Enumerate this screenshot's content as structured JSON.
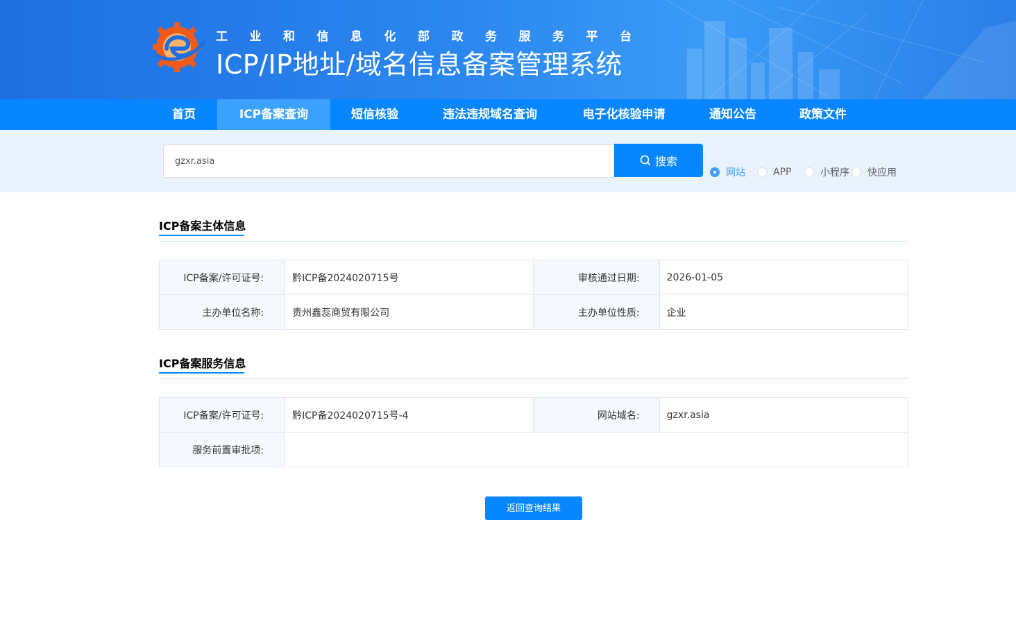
{
  "header": {
    "subtitle": "工业和信息化部政务服务平台",
    "title": "ICP/IP地址/域名信息备案管理系统"
  },
  "nav": {
    "items": [
      {
        "label": "首页"
      },
      {
        "label": "ICP备案查询",
        "active": true
      },
      {
        "label": "短信核验"
      },
      {
        "label": "违法违规域名查询"
      },
      {
        "label": "电子化核验申请"
      },
      {
        "label": "通知公告"
      },
      {
        "label": "政策文件"
      }
    ]
  },
  "search": {
    "value": "gzxr.asia",
    "button_label": "搜索",
    "types": [
      {
        "label": "网站",
        "checked": true
      },
      {
        "label": "APP",
        "checked": false
      },
      {
        "label": "小程序",
        "checked": false
      },
      {
        "label": "快应用",
        "checked": false
      }
    ]
  },
  "subject_info": {
    "title": "ICP备案主体信息",
    "rows": [
      {
        "label1": "ICP备案/许可证号:",
        "value1": "黔ICP备2024020715号",
        "label2": "审核通过日期:",
        "value2": "2026-01-05"
      },
      {
        "label1": "主办单位名称:",
        "value1": "贵州鑫蕊商贸有限公司",
        "label2": "主办单位性质:",
        "value2": "企业"
      }
    ]
  },
  "service_info": {
    "title": "ICP备案服务信息",
    "row1": {
      "label1": "ICP备案/许可证号:",
      "value1": "黔ICP备2024020715号-4",
      "label2": "网站域名:",
      "value2": "gzxr.asia"
    },
    "row2": {
      "label": "服务前置审批项:",
      "value": ""
    }
  },
  "back_button_label": "返回查询结果",
  "colors": {
    "primary": "#0886ff",
    "nav_active": "#3ba3ff",
    "search_band": "#e8f3fd",
    "radio_checked": "#409eff",
    "logo_orange": "#f05a1a",
    "logo_blue": "#1e6fe0"
  }
}
